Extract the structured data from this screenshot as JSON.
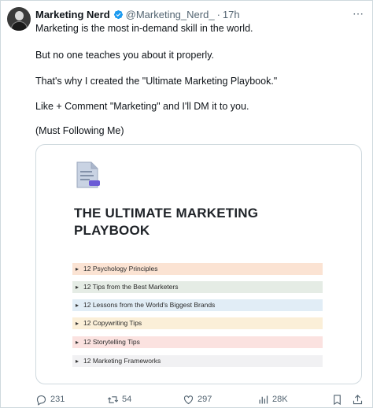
{
  "tweet": {
    "display_name": "Marketing Nerd",
    "handle": "@Marketing_Nerd_",
    "separator": "·",
    "time": "17h",
    "more_icon": "more-icon",
    "lines": [
      "Marketing is the most in-demand skill in the world.",
      "But no one teaches you about it properly.",
      "That's why I created the \"Ultimate Marketing Playbook.\"",
      "Like + Comment \"Marketing\" and I'll DM it to you.",
      "(Must Following Me)"
    ],
    "colors": {
      "verified": "#1d9bf0",
      "secondary_text": "#536471",
      "border": "#cfd9de"
    }
  },
  "card": {
    "title_line1": "THE ULTIMATE MARKETING",
    "title_line2": "PLAYBOOK",
    "items": [
      {
        "label": "12 Psychology Principles",
        "color": "#fbe3d3"
      },
      {
        "label": "12 Tips from the Best Marketers",
        "color": "#e5ece5"
      },
      {
        "label": "12 Lessons from the World's Biggest Brands",
        "color": "#e1edf6"
      },
      {
        "label": "12 Copywriting Tips",
        "color": "#fbefd8"
      },
      {
        "label": "12 Storytelling Tips",
        "color": "#fbe2e0"
      },
      {
        "label": "12 Marketing Frameworks",
        "color": "#f1f1f3"
      }
    ]
  },
  "actions": {
    "replies": "231",
    "retweets": "54",
    "likes": "297",
    "views": "28K"
  }
}
